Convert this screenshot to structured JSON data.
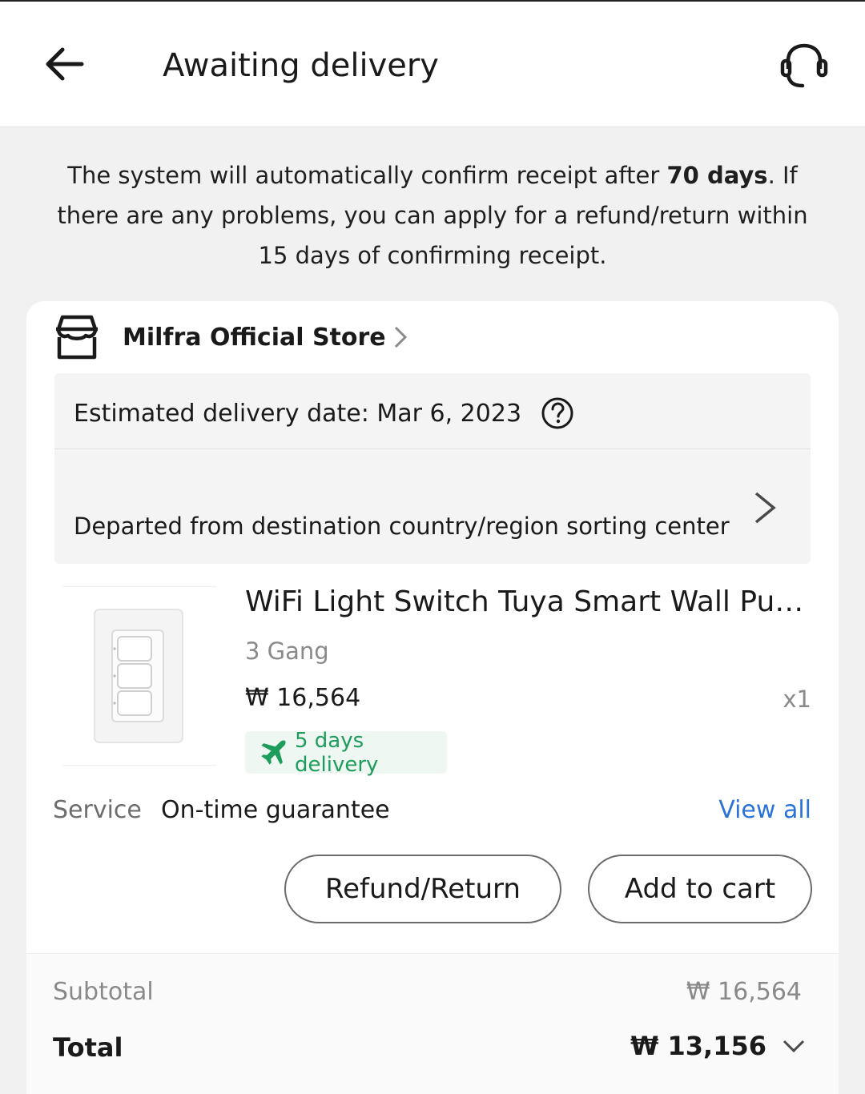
{
  "header": {
    "title": "Awaiting delivery",
    "back_icon": "arrow-left-icon",
    "support_icon": "headset-icon"
  },
  "notice": {
    "part1": "The system will automatically confirm receipt after ",
    "days": "70 days",
    "part2": ". If there are any problems, you can apply for a refund/return within 15 days of confirming receipt."
  },
  "order": {
    "store_icon": "store-icon",
    "store_name": "Milfra Official Store",
    "estimated_delivery": "Estimated delivery date: Mar 6, 2023",
    "tracking_status": "Departed from destination country/region sorting center",
    "product": {
      "title": "WiFi Light Switch Tuya Smart Wall Push Button Switch",
      "variant": "3 Gang",
      "price": "₩ 16,564",
      "quantity": "x1",
      "badge_icon": "plane-icon",
      "badge": "5 days delivery"
    },
    "service_label": "Service",
    "service_value": "On-time guarantee",
    "view_all": "View all",
    "refund_button": "Refund/Return",
    "add_to_cart_button": "Add to cart"
  },
  "summary": {
    "subtotal_label": "Subtotal",
    "subtotal_value": "₩ 16,564",
    "total_label": "Total",
    "total_value": "₩ 13,156"
  },
  "colors": {
    "accent_link": "#2a73d9",
    "badge_green": "#1e9c5b",
    "badge_bg": "#eef7f1",
    "page_bg": "#f1f1f1"
  }
}
